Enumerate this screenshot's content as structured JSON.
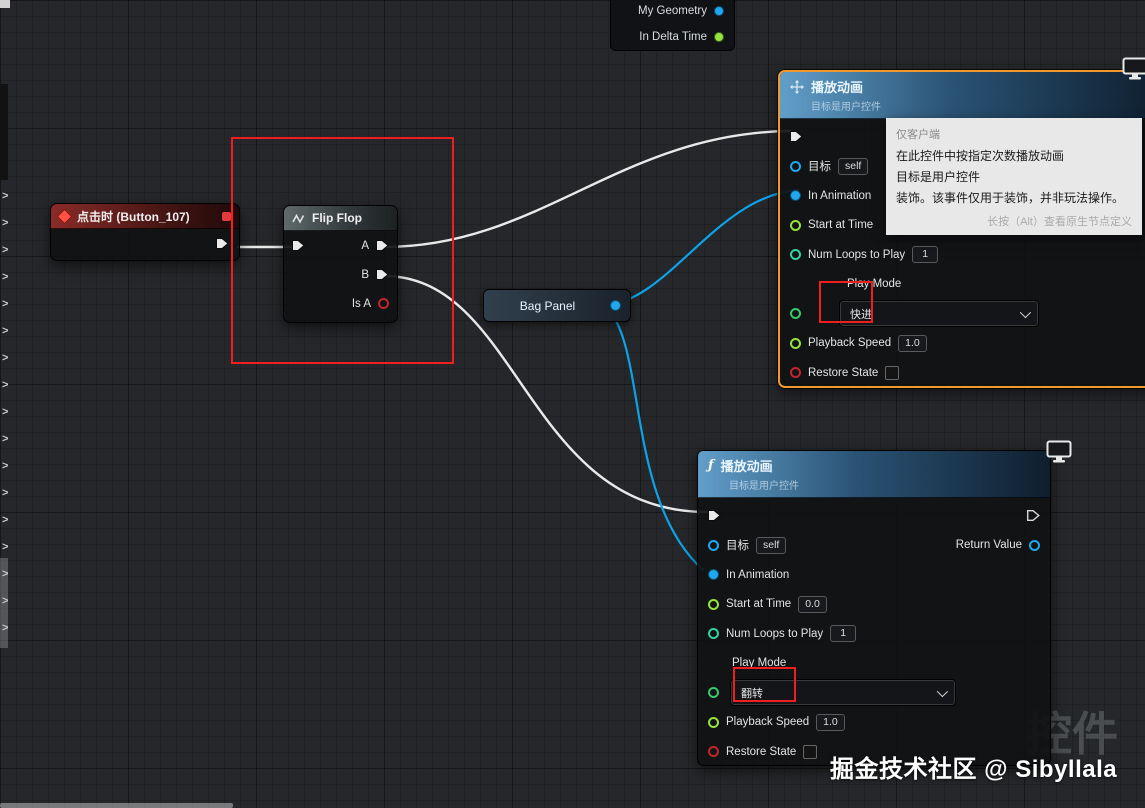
{
  "colors": {
    "selection": "#F2992E",
    "exec_wire": "#E9E9E9",
    "object_pin": "#1FA8F0",
    "float_pin": "#96E33E",
    "int_pin": "#35D39C",
    "enum_pin": "#35C96C",
    "bool_pin": "#C0262B",
    "annotation": "#EF1F1F",
    "object_wire": "#0DA2E7"
  },
  "partial_node": {
    "outputs": [
      {
        "label": "My Geometry"
      },
      {
        "label": "In Delta Time"
      }
    ]
  },
  "event_node": {
    "title": "点击时 (Button_107)"
  },
  "flipflop": {
    "title": "Flip Flop",
    "a": "A",
    "b": "B",
    "is_a": "Is A"
  },
  "bag_panel": {
    "label": "Bag Panel"
  },
  "play_top": {
    "title": "播放动画",
    "subtitle": "目标是用户控件",
    "target_label": "目标",
    "target_value": "self",
    "in_animation": "In Animation",
    "start_at_time": "Start at Time",
    "num_loops": "Num Loops to Play",
    "num_loops_value": "1",
    "play_mode": "Play Mode",
    "play_mode_value": "快进",
    "playback_speed": "Playback Speed",
    "playback_speed_value": "1.0",
    "restore_state": "Restore State"
  },
  "play_bottom": {
    "title": "播放动画",
    "subtitle": "目标是用户控件",
    "target_label": "目标",
    "target_value": "self",
    "return_value": "Return Value",
    "in_animation": "In Animation",
    "start_at_time": "Start at Time",
    "start_value": "0.0",
    "num_loops": "Num Loops to Play",
    "num_loops_value": "1",
    "play_mode": "Play Mode",
    "play_mode_value": "翻转",
    "playback_speed": "Playback Speed",
    "playback_speed_value": "1.0",
    "restore_state": "Restore State"
  },
  "tooltip": {
    "context": "仅客户端",
    "line1": "在此控件中按指定次数播放动画",
    "line2": "目标是用户控件",
    "line3": "装饰。该事件仅用于装饰，并非玩法操作。",
    "hint": "长按（Alt）查看原生节点定义"
  },
  "watermark": "掘金技术社区 @ Sibyllala",
  "bg_text": "控件"
}
